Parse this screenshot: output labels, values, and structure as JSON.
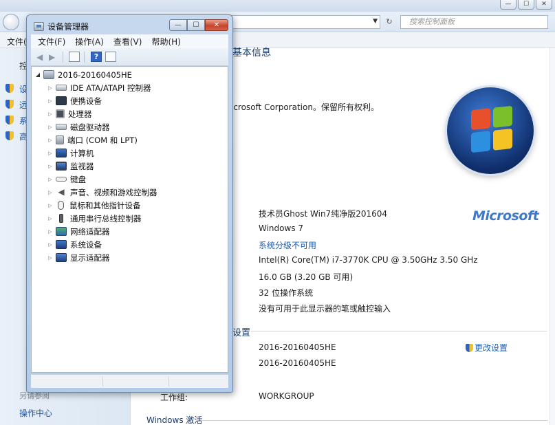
{
  "background_window": {
    "address_placeholder": "",
    "search_placeholder": "搜索控制面板",
    "menu_file": "文件(F)",
    "sidebar": {
      "header": "控",
      "items": [
        "设",
        "远",
        "系",
        "高"
      ],
      "footer_header": "另请参阅",
      "footer_link": "操作中心"
    },
    "main": {
      "section_basic": "基本信息",
      "copyright": "icrosoft Corporation。保留所有权利。",
      "manufacturer_value": "技术员Ghost Win7纯净版201604",
      "edition_value": "Windows 7",
      "rating_link": "系统分级不可用",
      "processor_value": "Intel(R) Core(TM) i7-3770K CPU @ 3.50GHz   3.50 GHz",
      "memory_value": "16.0 GB (3.20 GB 可用)",
      "system_type_value": "32 位操作系统",
      "pen_touch_value": "没有可用于此显示器的笔或触控输入",
      "section_settings": "设置",
      "computer_name_value": "2016-20160405HE",
      "full_name_value": "2016-20160405HE",
      "workgroup_label": "工作组:",
      "workgroup_value": "WORKGROUP",
      "change_settings_link": "更改设置",
      "activation_header": "Windows 激活",
      "ms_logo": "Microsoft"
    }
  },
  "device_manager": {
    "title": "设备管理器",
    "menus": [
      "文件(F)",
      "操作(A)",
      "查看(V)",
      "帮助(H)"
    ],
    "root": "2016-20160405HE",
    "categories": [
      {
        "label": "IDE ATA/ATAPI 控制器",
        "icon": "ide-controller-icon"
      },
      {
        "label": "便携设备",
        "icon": "portable-device-icon"
      },
      {
        "label": "处理器",
        "icon": "processor-icon"
      },
      {
        "label": "磁盘驱动器",
        "icon": "disk-drive-icon"
      },
      {
        "label": "端口 (COM 和 LPT)",
        "icon": "port-icon"
      },
      {
        "label": "计算机",
        "icon": "computer-icon"
      },
      {
        "label": "监视器",
        "icon": "monitor-icon"
      },
      {
        "label": "键盘",
        "icon": "keyboard-icon"
      },
      {
        "label": "声音、视频和游戏控制器",
        "icon": "sound-icon"
      },
      {
        "label": "鼠标和其他指针设备",
        "icon": "mouse-icon"
      },
      {
        "label": "通用串行总线控制器",
        "icon": "usb-icon"
      },
      {
        "label": "网络适配器",
        "icon": "network-adapter-icon"
      },
      {
        "label": "系统设备",
        "icon": "system-device-icon"
      },
      {
        "label": "显示适配器",
        "icon": "display-adapter-icon"
      }
    ]
  }
}
